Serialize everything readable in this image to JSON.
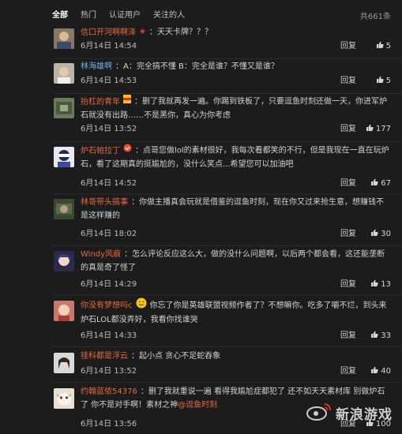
{
  "tabs": [
    {
      "label": "全部",
      "active": true
    },
    {
      "label": "热门",
      "active": false
    },
    {
      "label": "认证用户",
      "active": false
    },
    {
      "label": "关注的人",
      "active": false
    }
  ],
  "total": "共661条",
  "reply_label": "回复",
  "comments": [
    {
      "user": "信口开河啊啊泽",
      "badge": "★",
      "text": "天天卡牌？？？",
      "time": "6月14日 14:54",
      "likes": "5"
    },
    {
      "user": "林海雄啊",
      "text": "A：完全搞不懂 B：完全是谁？不懂又是谁？",
      "time": "6月14日 14:53",
      "likes": "5"
    },
    {
      "user": "抬杠的青年",
      "text": "删了我就再发一遍。你踢到铁板了，只要逗鱼时刻还做一天，你进军炉石就没有出路……不是黑你，真心为你考虑",
      "time": "6月14日 13:52",
      "likes": "177"
    },
    {
      "user": "炉石帕拉丁",
      "text": "点哥您做lol的素材很好，我每次看都笑的不行，但是我现在一直在玩炉石，看了这期真的挺尴尬的，没什么笑点...希望您可以加油吧",
      "time": "6月14日 14:52",
      "likes": "67"
    },
    {
      "user": "林哥带头搞事",
      "text": "你做主播真会玩就是借鉴的逗鱼时刻，现在你又过来抢生意，想赚钱不是这样赚的",
      "time": "6月14日 18:02",
      "likes": "30"
    },
    {
      "user": "Windy风痕",
      "text": "怎么评论反应这么大，做的没什么问题啊，以后两个都会看，这还能垄断的真是奇了怪了",
      "time": "6月14日 14:29",
      "likes": "13"
    },
    {
      "user": "你没有梦想吗c",
      "text": "你忘了你是英雄联盟视频作者了？不想嘛你。吃多了嚼不烂，到头来炉石LOL都没弄好，我看你找谁哭",
      "time": "6月14日 14:33",
      "likes": "33"
    },
    {
      "user": "挂科都是浮云",
      "text": "起小点 贪心不足蛇吞象",
      "time": "6月14日 13:52",
      "likes": "40"
    },
    {
      "user": "约翰蓝侬54376",
      "text": "删了我就重说一遍 看得我尴尬症都犯了 还不如天天素材库 别做炉石了 你不是对手啊！素材之神",
      "mention": "@逗鱼时刻",
      "time": "6月14日 13:56",
      "likes": "100"
    }
  ],
  "watermark": "新浪游戏",
  "colors": {
    "background": "#1c1c1c",
    "username": "#e46a3e",
    "username_alt": "#6fb0e8",
    "text": "#d2d2d2"
  }
}
